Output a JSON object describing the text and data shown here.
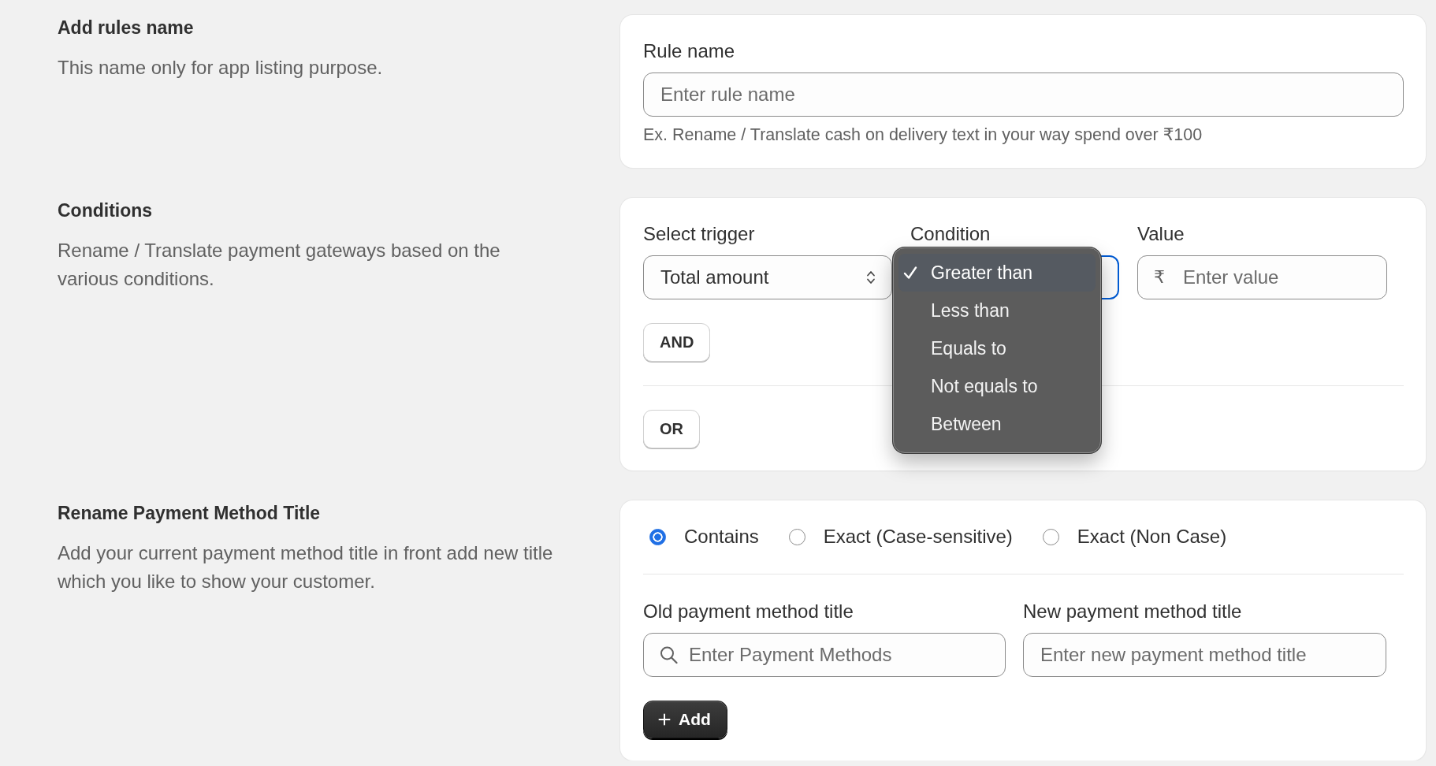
{
  "sections": [
    {
      "kind": "rule_name",
      "heading": "Add rules name",
      "description": "This name only for app listing purpose.",
      "field": {
        "label": "Rule name",
        "placeholder": "Enter rule name",
        "help": "Ex. Rename / Translate cash on delivery text in your way spend over ₹100"
      }
    },
    {
      "kind": "conditions",
      "heading": "Conditions",
      "description": "Rename / Translate payment gateways based on the various conditions.",
      "trigger": {
        "label": "Select trigger",
        "value": "Total amount"
      },
      "condition": {
        "label": "Condition",
        "focused": true,
        "expanded": true,
        "options": [
          {
            "label": "Greater than",
            "selected": true
          },
          {
            "label": "Less than",
            "selected": false
          },
          {
            "label": "Equals to",
            "selected": false
          },
          {
            "label": "Not equals to",
            "selected": false
          },
          {
            "label": "Between",
            "selected": false
          }
        ]
      },
      "value": {
        "label": "Value",
        "prefix": "₹",
        "placeholder": "Enter value"
      },
      "and_button": "AND",
      "or_button": "OR"
    },
    {
      "kind": "rename",
      "heading": "Rename Payment Method Title",
      "description": "Add your current payment method title in front add new title which you like to show your customer.",
      "match_options": [
        {
          "label": "Contains",
          "selected": true
        },
        {
          "label": "Exact (Case-sensitive)",
          "selected": false
        },
        {
          "label": "Exact (Non Case)",
          "selected": false
        }
      ],
      "old_title": {
        "label": "Old payment method title",
        "placeholder": "Enter Payment Methods"
      },
      "new_title": {
        "label": "New payment method title",
        "placeholder": "Enter new payment method title"
      },
      "add_button": "Add"
    }
  ]
}
